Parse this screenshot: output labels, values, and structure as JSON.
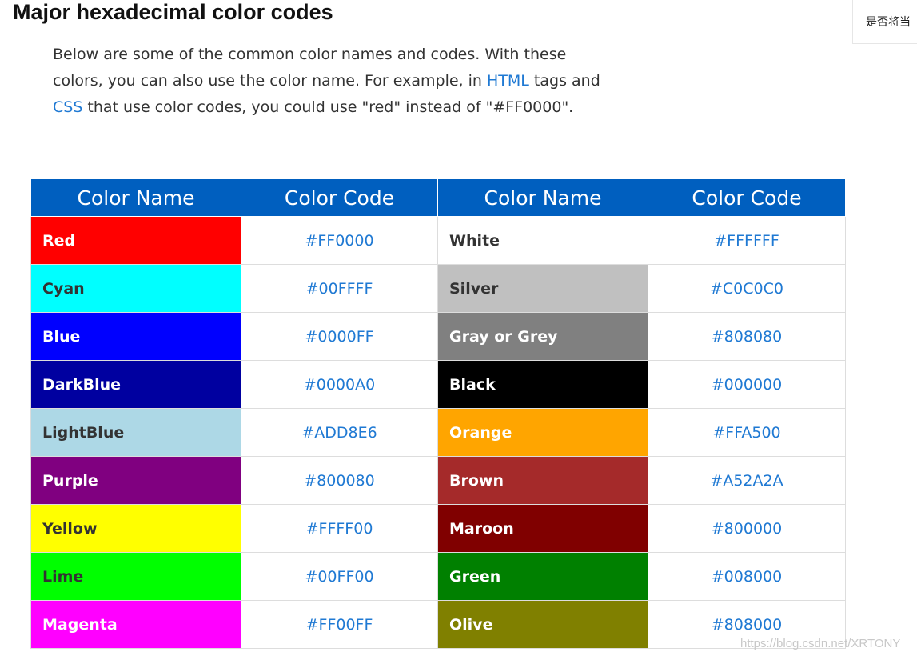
{
  "page": {
    "title": "Major hexadecimal color codes",
    "side_widget_text": "是否将当",
    "intro": {
      "part1": "Below are some of the common color names and codes. With these colors, you can also use the color name. For example, in ",
      "link_html": "HTML",
      "part2": " tags and ",
      "link_css": "CSS",
      "part3": " that use color codes, you could use \"red\" instead of \"#FF0000\"."
    },
    "watermark": "https://blog.csdn.net/XRTONY"
  },
  "table": {
    "headers": [
      "Color Name",
      "Color Code",
      "Color Name",
      "Color Code"
    ],
    "header_bg": "#005FBF",
    "rows": [
      {
        "left": {
          "name": "Red",
          "code": "#FF0000",
          "bg": "#FF0000",
          "fg": "#FFFFFF"
        },
        "right": {
          "name": "White",
          "code": "#FFFFFF",
          "bg": "#FFFFFF",
          "fg": "#333333"
        }
      },
      {
        "left": {
          "name": "Cyan",
          "code": "#00FFFF",
          "bg": "#00FFFF",
          "fg": "#333333"
        },
        "right": {
          "name": "Silver",
          "code": "#C0C0C0",
          "bg": "#C0C0C0",
          "fg": "#333333"
        }
      },
      {
        "left": {
          "name": "Blue",
          "code": "#0000FF",
          "bg": "#0000FF",
          "fg": "#FFFFFF"
        },
        "right": {
          "name": "Gray or Grey",
          "code": "#808080",
          "bg": "#808080",
          "fg": "#FFFFFF"
        }
      },
      {
        "left": {
          "name": "DarkBlue",
          "code": "#0000A0",
          "bg": "#0000A0",
          "fg": "#FFFFFF"
        },
        "right": {
          "name": "Black",
          "code": "#000000",
          "bg": "#000000",
          "fg": "#FFFFFF"
        }
      },
      {
        "left": {
          "name": "LightBlue",
          "code": "#ADD8E6",
          "bg": "#ADD8E6",
          "fg": "#333333"
        },
        "right": {
          "name": "Orange",
          "code": "#FFA500",
          "bg": "#FFA500",
          "fg": "#FFFFFF"
        }
      },
      {
        "left": {
          "name": "Purple",
          "code": "#800080",
          "bg": "#800080",
          "fg": "#FFFFFF"
        },
        "right": {
          "name": "Brown",
          "code": "#A52A2A",
          "bg": "#A52A2A",
          "fg": "#FFFFFF"
        }
      },
      {
        "left": {
          "name": "Yellow",
          "code": "#FFFF00",
          "bg": "#FFFF00",
          "fg": "#333333"
        },
        "right": {
          "name": "Maroon",
          "code": "#800000",
          "bg": "#800000",
          "fg": "#FFFFFF"
        }
      },
      {
        "left": {
          "name": "Lime",
          "code": "#00FF00",
          "bg": "#00FF00",
          "fg": "#333333"
        },
        "right": {
          "name": "Green",
          "code": "#008000",
          "bg": "#008000",
          "fg": "#FFFFFF"
        }
      },
      {
        "left": {
          "name": "Magenta",
          "code": "#FF00FF",
          "bg": "#FF00FF",
          "fg": "#FFFFFF"
        },
        "right": {
          "name": "Olive",
          "code": "#808000",
          "bg": "#808000",
          "fg": "#FFFFFF"
        }
      }
    ]
  },
  "colors": {
    "link": "#1F79D3",
    "body_text": "#333333",
    "title_text": "#111111"
  }
}
